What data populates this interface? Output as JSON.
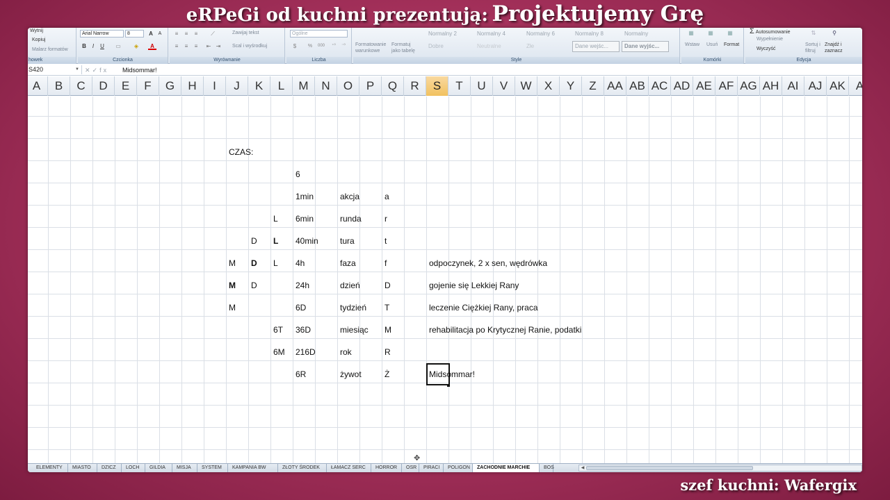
{
  "overlay": {
    "title_prefix": "eRPeGi od kuchni prezentują:",
    "title_main": "Projektujemy Grę",
    "footer": "szef kuchni: Wafergix"
  },
  "ribbon": {
    "clipboard": {
      "label": "howek",
      "items": [
        "Wytnij",
        "Kopiuj",
        "Malarz formatów"
      ]
    },
    "font": {
      "label": "Czcionka",
      "name": "Arial Narrow",
      "size": "8",
      "grow": "A",
      "shrink": "A",
      "bold": "B",
      "italic": "I",
      "underline": "U",
      "fontcolor": "A"
    },
    "alignment": {
      "label": "Wyrównanie",
      "wrap": "Zawijaj tekst",
      "merge": "Scal i wyśrodkuj"
    },
    "number": {
      "label": "Liczba",
      "format": "Ogólne",
      "percent": "%",
      "thousands": "000"
    },
    "styles": {
      "label": "Style",
      "cond_format": [
        "Formatowanie",
        "warunkowe"
      ],
      "as_table": [
        "Formatuj",
        "jako tabelę"
      ],
      "row1": [
        "Normalny 2",
        "Normalny 4",
        "Normalny 6",
        "Normalny 8",
        "Normalny"
      ],
      "row2": [
        "Dobre",
        "Neutralne",
        "Złe",
        "Dane wejśc...",
        "Dane wyjśc..."
      ]
    },
    "cells": {
      "label": "Komórki",
      "insert": "Wstaw",
      "delete": "Usuń",
      "format": "Format"
    },
    "editing": {
      "label": "Edycja",
      "autosum": "Autosumowanie",
      "fill": "Wypełnienie",
      "clear": "Wyczyść",
      "sort": [
        "Sortuj i",
        "filtruj"
      ],
      "find": [
        "Znajdź i",
        "zaznacz"
      ]
    }
  },
  "formula_bar": {
    "name_box": "S420",
    "fx": "fx",
    "content": "Midsommar!"
  },
  "columns": [
    "A",
    "B",
    "C",
    "D",
    "E",
    "F",
    "G",
    "H",
    "I",
    "J",
    "K",
    "L",
    "M",
    "N",
    "O",
    "P",
    "Q",
    "R",
    "S",
    "T",
    "U",
    "V",
    "W",
    "X",
    "Y",
    "Z",
    "AA",
    "AB",
    "AC",
    "AD",
    "AE",
    "AF",
    "AG",
    "AH",
    "AI",
    "AJ",
    "AK",
    "A"
  ],
  "selected_column": "S",
  "cells": {
    "r1_j": "CZAS:",
    "r2_m": "6",
    "r3_m": "1min",
    "r3_o": "akcja",
    "r3_q": "a",
    "r4_l": "L",
    "r4_m": "6min",
    "r4_o": "runda",
    "r4_q": "r",
    "r5_k": "D",
    "r5_l": "L",
    "r5_m": "40min",
    "r5_o": "tura",
    "r5_q": "t",
    "r6_j": "M",
    "r6_k": "D",
    "r6_l": "L",
    "r6_m": "4h",
    "r6_o": "faza",
    "r6_q": "f",
    "r6_s": "odpoczynek, 2 x sen, wędrówka",
    "r7_j": "M",
    "r7_k": "D",
    "r7_m": "24h",
    "r7_o": "dzień",
    "r7_q": "D",
    "r7_s": "gojenie się Lekkiej Rany",
    "r8_j": "M",
    "r8_m": "6D",
    "r8_o": "tydzień",
    "r8_q": "T",
    "r8_s": "leczenie Ciężkiej Rany, praca",
    "r9_l": "6T",
    "r9_m": "36D",
    "r9_o": "miesiąc",
    "r9_q": "M",
    "r9_s": "rehabilitacja po Krytycznej Ranie, podatki",
    "r10_l": "6M",
    "r10_m": "216D",
    "r10_o": "rok",
    "r10_q": "R",
    "r11_m": "6R",
    "r11_o": "żywot",
    "r11_q": "Ż",
    "r11_s": "Midsommar!"
  },
  "sheet_tabs": [
    "ELEMENTY",
    "MIASTO",
    "DZICZ",
    "LOCH",
    "GILDIA",
    "MISJA",
    "SYSTEM",
    "KAMPANIA BW",
    "ZŁOTY ŚRODEK",
    "ŁAMACZ SERC",
    "HORROR",
    "OSR",
    "PIRACI",
    "POLIGON",
    "ZACHODNIE MARCHIE",
    "BOS"
  ],
  "active_tab": "ZACHODNIE MARCHIE"
}
